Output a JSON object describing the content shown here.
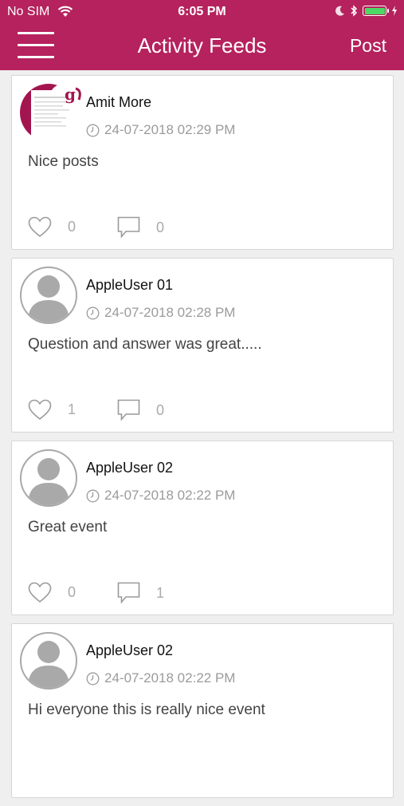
{
  "status_bar": {
    "carrier": "No SIM",
    "time": "6:05 PM",
    "battery_level": 1.0,
    "battery_color": "#4cd964"
  },
  "header": {
    "title": "Activity Feeds",
    "post_label": "Post",
    "background": "#b5225d"
  },
  "posts": [
    {
      "user": "Amit More",
      "timestamp": "24-07-2018 02:29 PM",
      "text": "Nice posts",
      "likes": "0",
      "comments": "0",
      "avatar": "photo-avatar"
    },
    {
      "user": "AppleUser 01",
      "timestamp": "24-07-2018 02:28 PM",
      "text": "Question and answer was great.....",
      "likes": "1",
      "comments": "0",
      "avatar": "person-placeholder-icon"
    },
    {
      "user": "AppleUser 02",
      "timestamp": "24-07-2018 02:22 PM",
      "text": "Great event",
      "likes": "0",
      "comments": "1",
      "avatar": "person-placeholder-icon"
    },
    {
      "user": "AppleUser 02",
      "timestamp": "24-07-2018 02:22 PM",
      "text": "Hi everyone this is really nice event",
      "likes": "",
      "comments": "",
      "avatar": "person-placeholder-icon"
    }
  ]
}
